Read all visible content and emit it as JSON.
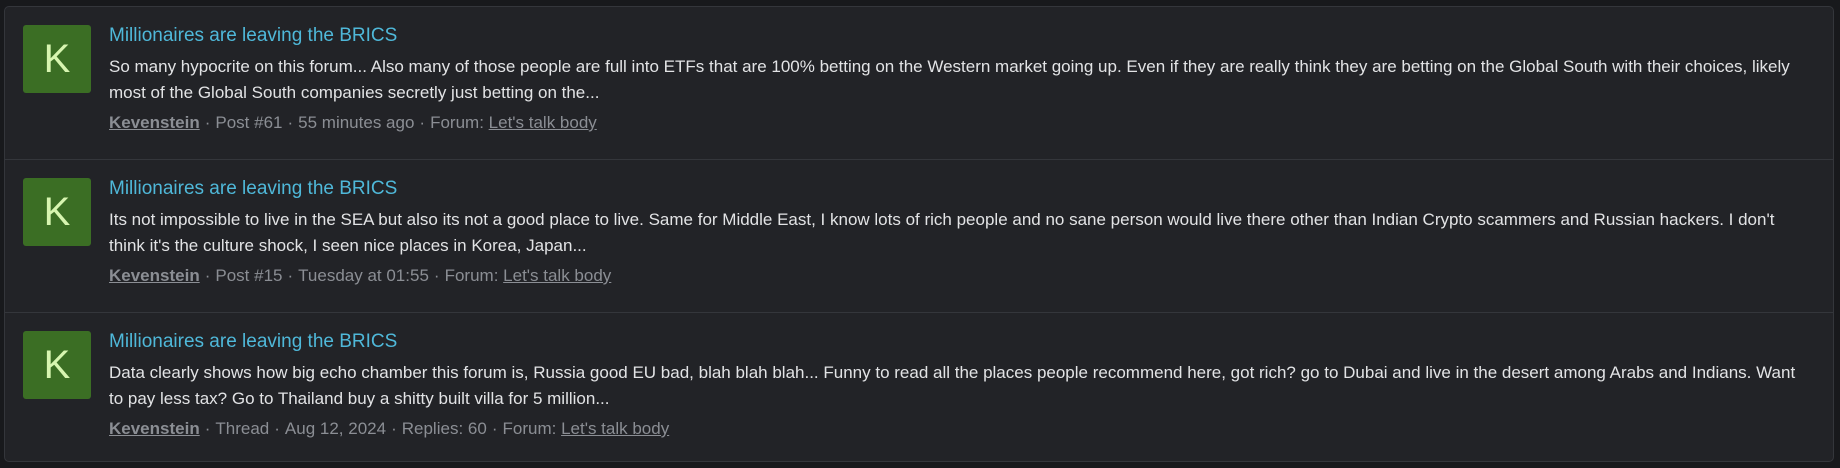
{
  "results": [
    {
      "avatar_letter": "K",
      "title": "Millionaires are leaving the BRICS",
      "snippet": "So many hypocrite on this forum... Also many of those people are full into ETFs that are 100% betting on the Western market going up. Even if they are really think they are betting on the Global South with their choices, likely most of the Global South companies secretly just betting on the...",
      "author": "Kevenstein",
      "type": "Post #61",
      "date": "55 minutes ago",
      "replies": null,
      "forum_label": "Forum:",
      "forum": "Let's talk body"
    },
    {
      "avatar_letter": "K",
      "title": "Millionaires are leaving the BRICS",
      "snippet": "Its not impossible to live in the SEA but also its not a good place to live. Same for Middle East, I know lots of rich people and no sane person would live there other than Indian Crypto scammers and Russian hackers. I don't think it's the culture shock, I seen nice places in Korea, Japan...",
      "author": "Kevenstein",
      "type": "Post #15",
      "date": "Tuesday at 01:55",
      "replies": null,
      "forum_label": "Forum:",
      "forum": "Let's talk body"
    },
    {
      "avatar_letter": "K",
      "title": "Millionaires are leaving the BRICS",
      "snippet": "Data clearly shows how big echo chamber this forum is, Russia good EU bad, blah blah blah... Funny to read all the places people recommend here, got rich? go to Dubai and live in the desert among Arabs and Indians. Want to pay less tax? Go to Thailand buy a shitty built villa for 5 million...",
      "author": "Kevenstein",
      "type": "Thread",
      "date": "Aug 12, 2024",
      "replies": "Replies: 60",
      "forum_label": "Forum:",
      "forum": "Let's talk body"
    }
  ],
  "meta_separator": "·",
  "colors": {
    "background": "#18191c",
    "panel": "#222327",
    "title_link": "#4fb8d9",
    "avatar_bg": "#3b6e24",
    "avatar_text": "#d7f5b0",
    "meta_text": "#8b8e94"
  }
}
